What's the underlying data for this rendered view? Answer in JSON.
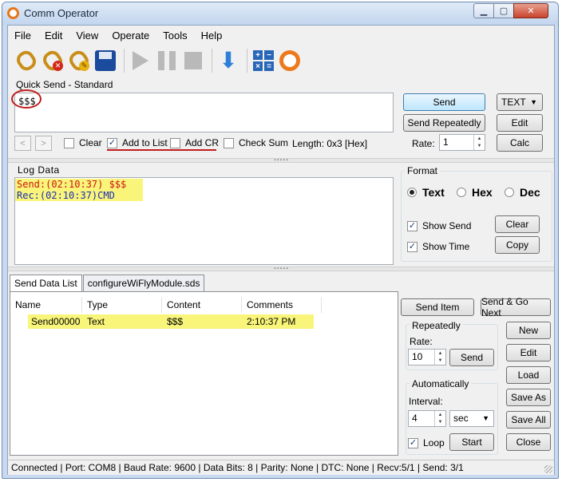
{
  "window": {
    "title": "Comm Operator"
  },
  "menu": [
    "File",
    "Edit",
    "View",
    "Operate",
    "Tools",
    "Help"
  ],
  "toolbar_icons": [
    "connect-icon",
    "disconnect-icon",
    "connect-settings-icon",
    "save-icon",
    "play-icon",
    "pause-icon",
    "stop-icon",
    "download-icon",
    "calculator-icon",
    "about-icon"
  ],
  "quick_send": {
    "label": "Quick Send - Standard",
    "text": "$$$",
    "nav_prev": "<",
    "nav_next": ">",
    "clear_label": "Clear",
    "add_to_list_label": "Add to List",
    "add_cr_label": "Add CR",
    "checksum_label": "Check Sum",
    "length_text": "Length: 0x3 [Hex]",
    "send_label": "Send",
    "send_repeatedly_label": "Send Repeatedly",
    "format_value": "TEXT",
    "edit_label": "Edit",
    "calc_label": "Calc",
    "rate_label": "Rate:",
    "rate_value": "1"
  },
  "log": {
    "label": "Log Data",
    "lines": [
      {
        "text": "Send:(02:10:37) $$$"
      },
      {
        "text": "Rec:(02:10:37)CMD"
      }
    ]
  },
  "format": {
    "label": "Format",
    "options": [
      "Text",
      "Hex",
      "Dec"
    ],
    "show_send_label": "Show Send",
    "show_time_label": "Show Time",
    "clear_label": "Clear",
    "copy_label": "Copy"
  },
  "tabs": [
    "Send Data List",
    "configureWiFlyModule.sds"
  ],
  "list": {
    "columns": [
      "Name",
      "Type",
      "Content",
      "Comments"
    ],
    "rows": [
      {
        "name": "Send00000",
        "type": "Text",
        "content": "$$$",
        "comments": "2:10:37 PM"
      }
    ]
  },
  "side": {
    "send_item_label": "Send Item",
    "send_go_next_label": "Send & Go Next",
    "repeatedly_label": "Repeatedly",
    "rate_label": "Rate:",
    "rate_value": "10",
    "send_label": "Send",
    "automatically_label": "Automatically",
    "interval_label": "Interval:",
    "interval_value": "4",
    "unit_value": "sec",
    "loop_label": "Loop",
    "start_label": "Start",
    "new_label": "New",
    "edit_label": "Edit",
    "load_label": "Load",
    "save_as_label": "Save As",
    "save_all_label": "Save All",
    "close_label": "Close"
  },
  "status": "Connected | Port: COM8 | Baud Rate: 9600 | Data Bits: 8 | Parity: None | DTC: None | Recv:5/1 | Send: 3/1"
}
